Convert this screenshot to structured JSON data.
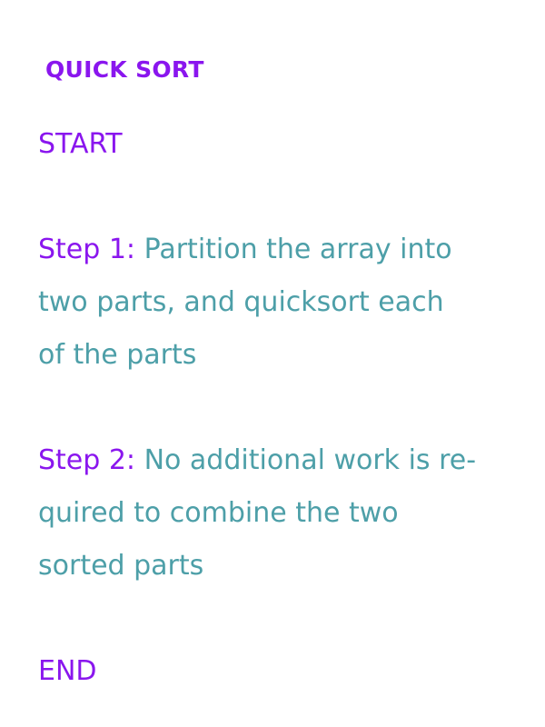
{
  "title": "QUICK SORT",
  "start_label": "START",
  "steps": [
    {
      "label": "Step 1:",
      "lines": [
        "Partition the array into",
        "two parts, and quicksort each",
        "of the parts"
      ]
    },
    {
      "label": "Step 2:",
      "lines": [
        "No additional work is re-",
        "quired to combine the two",
        "sorted parts"
      ]
    }
  ],
  "end_label": "END",
  "colors": {
    "accent": "#8a16ee",
    "body_text": "#4d9fa8",
    "background": "#ffffff"
  }
}
